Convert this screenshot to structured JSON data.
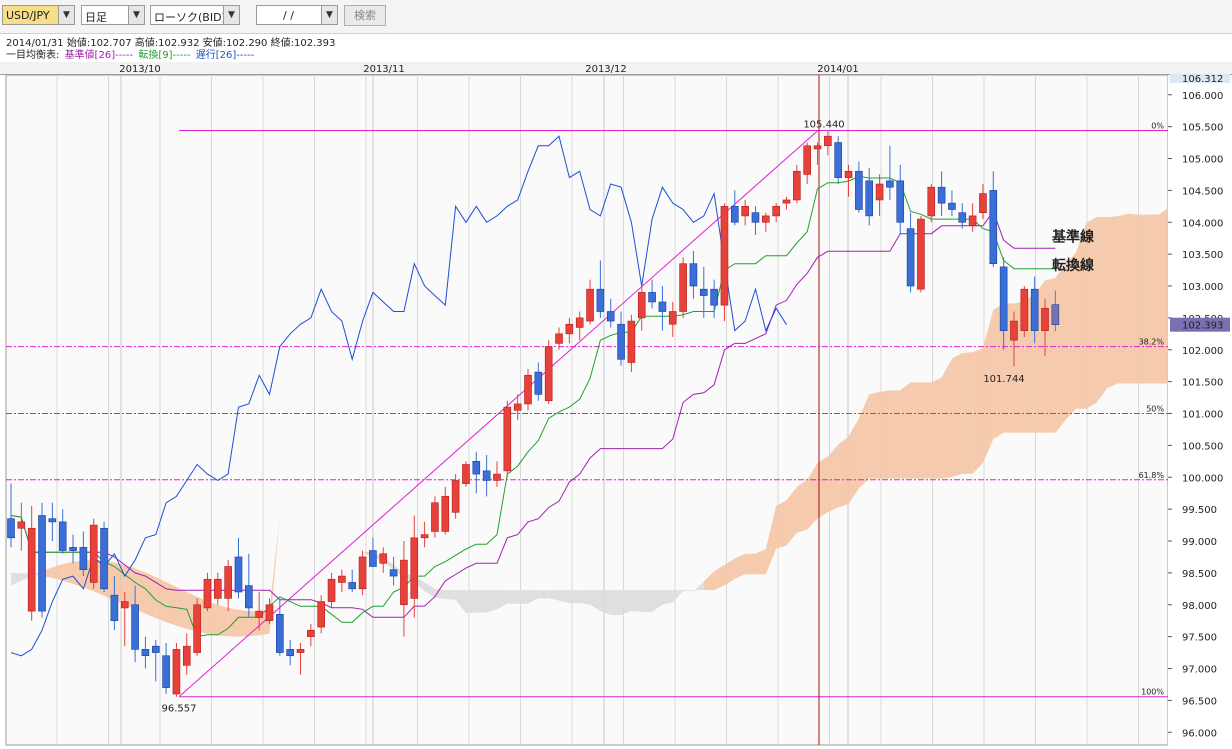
{
  "toolbar": {
    "symbol": "USD/JPY",
    "period": "日足",
    "chart_type": "ローソク(BID)",
    "date_value": "/    /",
    "search_label": "検索"
  },
  "ohlc_line": {
    "date": "2014/01/31",
    "open_label": "始値:",
    "open": "102.707",
    "high_label": "高値:",
    "high": "102.932",
    "low_label": "安値:",
    "low": "102.290",
    "close_label": "終値:",
    "close": "102.393"
  },
  "indicator_line": {
    "name": "一目均衡表:",
    "kijun": "基準値[26]-----",
    "tenkan": "転換[9]-----",
    "chikou": "遅行[26]-----"
  },
  "colors": {
    "up": "#e8413a",
    "down": "#3a6fd8",
    "kijun": "#a020b0",
    "tenkan": "#20a030",
    "chikou": "#1a4fd6",
    "cloud_up": "#f4c4a4",
    "cloud_down": "#dcdcdc",
    "fib": "#e020d0",
    "marker": "#b01010"
  },
  "chart_data": {
    "type": "candlestick",
    "title": "",
    "x_months": [
      "2013/10",
      "2013/11",
      "2013/12",
      "2014/01"
    ],
    "yticks": [
      "106.000",
      "105.500",
      "105.000",
      "104.500",
      "104.000",
      "103.500",
      "103.000",
      "102.500",
      "102.000",
      "101.500",
      "101.000",
      "100.500",
      "100.000",
      "99.500",
      "99.000",
      "98.500",
      "98.000",
      "97.500",
      "97.000",
      "96.500",
      "96.000"
    ],
    "ylim": [
      95.8,
      106.31
    ],
    "y_top_label": "106.312",
    "current_price": "102.393",
    "candles": [
      {
        "o": 99.35,
        "h": 99.9,
        "l": 98.9,
        "c": 99.05
      },
      {
        "o": 99.2,
        "h": 99.6,
        "l": 98.85,
        "c": 99.3
      },
      {
        "o": 97.9,
        "h": 99.55,
        "l": 97.75,
        "c": 99.2
      },
      {
        "o": 99.4,
        "h": 99.6,
        "l": 97.8,
        "c": 97.9
      },
      {
        "o": 99.35,
        "h": 99.6,
        "l": 99.0,
        "c": 99.3
      },
      {
        "o": 99.3,
        "h": 99.5,
        "l": 98.8,
        "c": 98.85
      },
      {
        "o": 98.9,
        "h": 99.1,
        "l": 98.65,
        "c": 98.85
      },
      {
        "o": 98.9,
        "h": 99.15,
        "l": 98.45,
        "c": 98.55
      },
      {
        "o": 98.35,
        "h": 99.35,
        "l": 98.25,
        "c": 99.25
      },
      {
        "o": 99.2,
        "h": 99.3,
        "l": 98.2,
        "c": 98.25
      },
      {
        "o": 98.15,
        "h": 98.45,
        "l": 97.6,
        "c": 97.75
      },
      {
        "o": 97.95,
        "h": 98.2,
        "l": 97.35,
        "c": 98.05
      },
      {
        "o": 98.0,
        "h": 98.3,
        "l": 97.1,
        "c": 97.3
      },
      {
        "o": 97.3,
        "h": 97.5,
        "l": 97.0,
        "c": 97.2
      },
      {
        "o": 97.35,
        "h": 97.45,
        "l": 96.8,
        "c": 97.25
      },
      {
        "o": 97.2,
        "h": 97.4,
        "l": 96.6,
        "c": 96.7
      },
      {
        "o": 96.6,
        "h": 97.4,
        "l": 96.557,
        "c": 97.3
      },
      {
        "o": 97.05,
        "h": 97.55,
        "l": 96.9,
        "c": 97.35
      },
      {
        "o": 97.25,
        "h": 98.1,
        "l": 97.2,
        "c": 98.0
      },
      {
        "o": 97.95,
        "h": 98.5,
        "l": 97.9,
        "c": 98.4
      },
      {
        "o": 98.1,
        "h": 98.5,
        "l": 98.0,
        "c": 98.4
      },
      {
        "o": 98.1,
        "h": 98.7,
        "l": 97.9,
        "c": 98.6
      },
      {
        "o": 98.75,
        "h": 99.05,
        "l": 98.1,
        "c": 98.2
      },
      {
        "o": 98.3,
        "h": 98.8,
        "l": 97.8,
        "c": 97.95
      },
      {
        "o": 97.8,
        "h": 98.2,
        "l": 97.6,
        "c": 97.9
      },
      {
        "o": 97.75,
        "h": 98.1,
        "l": 97.7,
        "c": 98.0
      },
      {
        "o": 97.85,
        "h": 98.1,
        "l": 97.2,
        "c": 97.25
      },
      {
        "o": 97.3,
        "h": 97.45,
        "l": 97.05,
        "c": 97.2
      },
      {
        "o": 97.25,
        "h": 97.4,
        "l": 96.9,
        "c": 97.3
      },
      {
        "o": 97.5,
        "h": 97.7,
        "l": 97.35,
        "c": 97.6
      },
      {
        "o": 97.65,
        "h": 98.15,
        "l": 97.55,
        "c": 98.05
      },
      {
        "o": 98.05,
        "h": 98.5,
        "l": 97.95,
        "c": 98.4
      },
      {
        "o": 98.35,
        "h": 98.55,
        "l": 98.2,
        "c": 98.45
      },
      {
        "o": 98.35,
        "h": 98.55,
        "l": 98.2,
        "c": 98.25
      },
      {
        "o": 98.25,
        "h": 98.85,
        "l": 98.15,
        "c": 98.75
      },
      {
        "o": 98.85,
        "h": 99.05,
        "l": 98.6,
        "c": 98.6
      },
      {
        "o": 98.65,
        "h": 98.9,
        "l": 98.5,
        "c": 98.8
      },
      {
        "o": 98.55,
        "h": 98.75,
        "l": 98.3,
        "c": 98.45
      },
      {
        "o": 98.0,
        "h": 99.0,
        "l": 97.5,
        "c": 98.7
      },
      {
        "o": 98.1,
        "h": 99.4,
        "l": 97.8,
        "c": 99.05
      },
      {
        "o": 99.05,
        "h": 99.3,
        "l": 98.9,
        "c": 99.1
      },
      {
        "o": 99.15,
        "h": 99.7,
        "l": 99.05,
        "c": 99.6
      },
      {
        "o": 99.15,
        "h": 99.85,
        "l": 99.1,
        "c": 99.7
      },
      {
        "o": 99.45,
        "h": 100.05,
        "l": 99.35,
        "c": 99.95
      },
      {
        "o": 99.9,
        "h": 100.25,
        "l": 99.85,
        "c": 100.2
      },
      {
        "o": 100.25,
        "h": 100.4,
        "l": 99.75,
        "c": 100.05
      },
      {
        "o": 100.1,
        "h": 100.35,
        "l": 99.7,
        "c": 99.95
      },
      {
        "o": 99.95,
        "h": 100.25,
        "l": 99.85,
        "c": 100.05
      },
      {
        "o": 100.1,
        "h": 101.2,
        "l": 100.0,
        "c": 101.1
      },
      {
        "o": 101.05,
        "h": 101.3,
        "l": 100.9,
        "c": 101.15
      },
      {
        "o": 101.15,
        "h": 101.7,
        "l": 101.05,
        "c": 101.6
      },
      {
        "o": 101.65,
        "h": 101.8,
        "l": 101.2,
        "c": 101.3
      },
      {
        "o": 101.2,
        "h": 102.15,
        "l": 101.15,
        "c": 102.05
      },
      {
        "o": 102.1,
        "h": 102.35,
        "l": 102.0,
        "c": 102.25
      },
      {
        "o": 102.25,
        "h": 102.5,
        "l": 102.1,
        "c": 102.4
      },
      {
        "o": 102.35,
        "h": 102.6,
        "l": 102.15,
        "c": 102.5
      },
      {
        "o": 102.45,
        "h": 103.1,
        "l": 102.4,
        "c": 102.95
      },
      {
        "o": 102.95,
        "h": 103.4,
        "l": 102.5,
        "c": 102.6
      },
      {
        "o": 102.6,
        "h": 102.8,
        "l": 102.35,
        "c": 102.45
      },
      {
        "o": 102.4,
        "h": 102.6,
        "l": 101.75,
        "c": 101.85
      },
      {
        "o": 101.8,
        "h": 102.55,
        "l": 101.65,
        "c": 102.45
      },
      {
        "o": 102.5,
        "h": 103.0,
        "l": 102.3,
        "c": 102.9
      },
      {
        "o": 102.9,
        "h": 103.1,
        "l": 102.65,
        "c": 102.75
      },
      {
        "o": 102.75,
        "h": 103.0,
        "l": 102.3,
        "c": 102.6
      },
      {
        "o": 102.4,
        "h": 102.75,
        "l": 102.2,
        "c": 102.6
      },
      {
        "o": 102.6,
        "h": 103.45,
        "l": 102.5,
        "c": 103.35
      },
      {
        "o": 103.35,
        "h": 103.55,
        "l": 102.8,
        "c": 103.0
      },
      {
        "o": 102.95,
        "h": 103.3,
        "l": 102.5,
        "c": 102.85
      },
      {
        "o": 102.95,
        "h": 103.1,
        "l": 102.5,
        "c": 102.7
      },
      {
        "o": 102.7,
        "h": 104.3,
        "l": 102.45,
        "c": 104.25
      },
      {
        "o": 104.25,
        "h": 104.5,
        "l": 103.95,
        "c": 104.0
      },
      {
        "o": 104.1,
        "h": 104.35,
        "l": 103.95,
        "c": 104.25
      },
      {
        "o": 104.15,
        "h": 104.25,
        "l": 103.8,
        "c": 104.0
      },
      {
        "o": 104.0,
        "h": 104.15,
        "l": 103.85,
        "c": 104.1
      },
      {
        "o": 104.1,
        "h": 104.3,
        "l": 104.0,
        "c": 104.25
      },
      {
        "o": 104.3,
        "h": 104.4,
        "l": 104.2,
        "c": 104.35
      },
      {
        "o": 104.35,
        "h": 104.9,
        "l": 104.3,
        "c": 104.8
      },
      {
        "o": 104.75,
        "h": 105.25,
        "l": 104.6,
        "c": 105.2
      },
      {
        "o": 105.15,
        "h": 105.25,
        "l": 104.9,
        "c": 105.2
      },
      {
        "o": 105.2,
        "h": 105.44,
        "l": 105.05,
        "c": 105.35
      },
      {
        "o": 105.25,
        "h": 105.35,
        "l": 104.6,
        "c": 104.7
      },
      {
        "o": 104.7,
        "h": 104.9,
        "l": 104.4,
        "c": 104.8
      },
      {
        "o": 104.8,
        "h": 104.95,
        "l": 104.15,
        "c": 104.2
      },
      {
        "o": 104.65,
        "h": 104.85,
        "l": 103.95,
        "c": 104.1
      },
      {
        "o": 104.35,
        "h": 104.75,
        "l": 104.1,
        "c": 104.6
      },
      {
        "o": 104.65,
        "h": 105.2,
        "l": 104.35,
        "c": 104.55
      },
      {
        "o": 104.65,
        "h": 104.9,
        "l": 103.8,
        "c": 104.0
      },
      {
        "o": 103.9,
        "h": 104.15,
        "l": 102.9,
        "c": 103.0
      },
      {
        "o": 102.95,
        "h": 104.1,
        "l": 102.9,
        "c": 104.05
      },
      {
        "o": 104.1,
        "h": 104.6,
        "l": 104.0,
        "c": 104.55
      },
      {
        "o": 104.55,
        "h": 104.8,
        "l": 104.1,
        "c": 104.3
      },
      {
        "o": 104.3,
        "h": 104.5,
        "l": 104.1,
        "c": 104.2
      },
      {
        "o": 104.15,
        "h": 104.3,
        "l": 103.9,
        "c": 104.0
      },
      {
        "o": 103.95,
        "h": 104.3,
        "l": 103.85,
        "c": 104.1
      },
      {
        "o": 104.15,
        "h": 104.6,
        "l": 104.05,
        "c": 104.45
      },
      {
        "o": 104.5,
        "h": 104.8,
        "l": 103.3,
        "c": 103.35
      },
      {
        "o": 103.3,
        "h": 103.45,
        "l": 102.0,
        "c": 102.3
      },
      {
        "o": 102.15,
        "h": 102.6,
        "l": 101.744,
        "c": 102.45
      },
      {
        "o": 102.3,
        "h": 103.0,
        "l": 102.2,
        "c": 102.95
      },
      {
        "o": 102.95,
        "h": 103.15,
        "l": 102.1,
        "c": 102.3
      },
      {
        "o": 102.3,
        "h": 102.8,
        "l": 101.9,
        "c": 102.65
      },
      {
        "o": 102.707,
        "h": 102.932,
        "l": 102.29,
        "c": 102.393
      }
    ],
    "fibonacci": [
      {
        "label": "0%",
        "value": 105.44
      },
      {
        "label": "38.2%",
        "value": 102.05
      },
      {
        "label": "50%",
        "value": 101.0
      },
      {
        "label": "61.8%",
        "value": 99.96
      },
      {
        "label": "100%",
        "value": 96.557
      }
    ],
    "annotations": {
      "high": "105.440",
      "low": "96.557",
      "recent_low": "101.744"
    },
    "legend_labels": {
      "kijun": "基準線",
      "tenkan": "転換線"
    }
  }
}
